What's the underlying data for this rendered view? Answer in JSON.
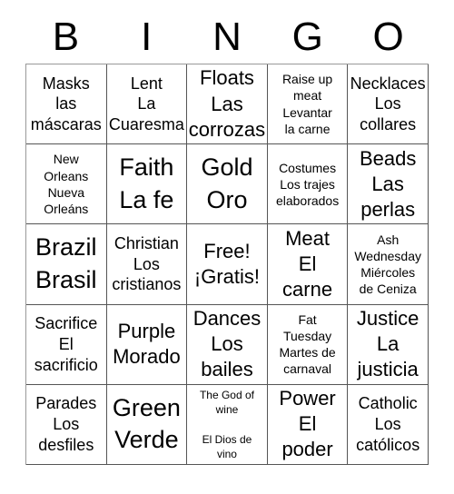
{
  "header": {
    "letters": [
      "B",
      "I",
      "N",
      "G",
      "O"
    ]
  },
  "grid": {
    "rows": [
      [
        {
          "text": "Masks\nlas\nmáscaras",
          "size": "md"
        },
        {
          "text": "Lent\nLa\nCuaresma",
          "size": "md"
        },
        {
          "text": "Floats\nLas\ncorrozas",
          "size": "lg"
        },
        {
          "text": "Raise up\nmeat\nLevantar\nla carne",
          "size": "sm"
        },
        {
          "text": "Necklaces\nLos\ncollares",
          "size": "md"
        }
      ],
      [
        {
          "text": "New\nOrleans\nNueva\nOrleáns",
          "size": "sm"
        },
        {
          "text": "Faith\nLa fe",
          "size": "xl"
        },
        {
          "text": "Gold\nOro",
          "size": "xl"
        },
        {
          "text": "Costumes\nLos trajes\nelaborados",
          "size": "sm"
        },
        {
          "text": "Beads\nLas\nperlas",
          "size": "lg"
        }
      ],
      [
        {
          "text": "Brazil\nBrasil",
          "size": "xl"
        },
        {
          "text": "Christian\nLos\ncristianos",
          "size": "md"
        },
        {
          "text": "Free!\n¡Gratis!",
          "size": "lg"
        },
        {
          "text": "Meat\nEl\ncarne",
          "size": "lg"
        },
        {
          "text": "Ash\nWednesday\nMiércoles\nde Ceniza",
          "size": "sm"
        }
      ],
      [
        {
          "text": "Sacrifice\nEl\nsacrificio",
          "size": "md"
        },
        {
          "text": "Purple\nMorado",
          "size": "lg"
        },
        {
          "text": "Dances\nLos\nbailes",
          "size": "lg"
        },
        {
          "text": "Fat\nTuesday\nMartes de\ncarnaval",
          "size": "sm"
        },
        {
          "text": "Justice\nLa\njusticia",
          "size": "lg"
        }
      ],
      [
        {
          "text": "Parades\nLos\ndesfiles",
          "size": "md"
        },
        {
          "text": "Green\nVerde",
          "size": "xl"
        },
        {
          "text": "The God of\nwine\n\nEl Dios de\nvino",
          "size": "xs"
        },
        {
          "text": "Power\nEl\npoder",
          "size": "lg"
        },
        {
          "text": "Catholic\nLos\ncatólicos",
          "size": "md"
        }
      ]
    ]
  }
}
